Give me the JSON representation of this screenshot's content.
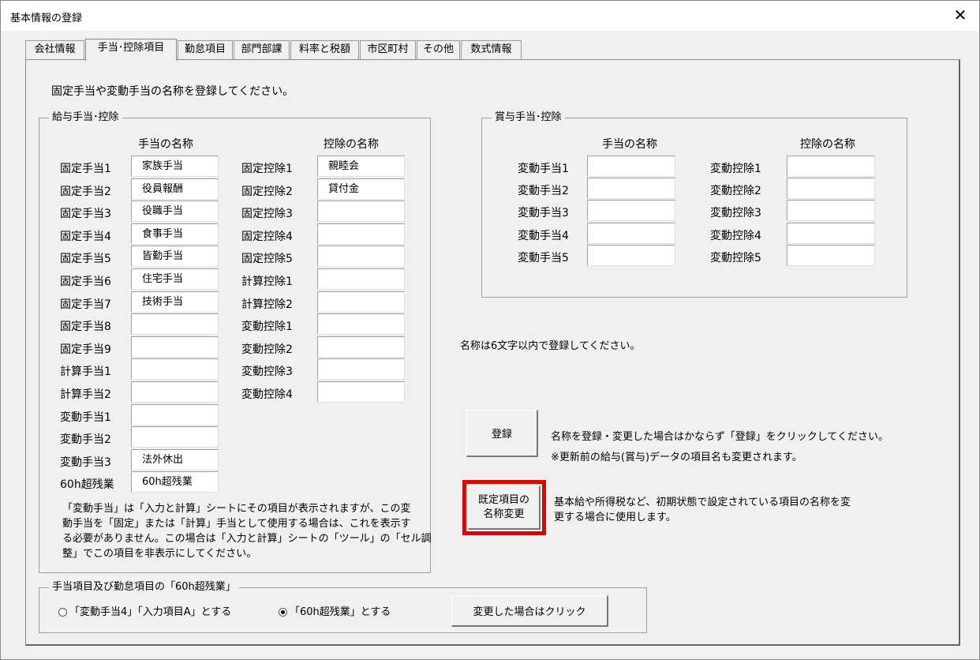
{
  "window": {
    "title": "基本情報の登録",
    "close_glyph": "✕"
  },
  "tabs": [
    "会社情報",
    "手当･控除項目",
    "勤怠項目",
    "部門部課",
    "料率と税額",
    "市区町村",
    "その他",
    "数式情報"
  ],
  "instruction": "固定手当や変動手当の名称を登録してください。",
  "salary": {
    "group_title": "給与手当･控除",
    "allow_header": "手当の名称",
    "deduct_header": "控除の名称",
    "allowances": [
      {
        "label": "固定手当1",
        "value": "家族手当"
      },
      {
        "label": "固定手当2",
        "value": "役員報酬"
      },
      {
        "label": "固定手当3",
        "value": "役職手当"
      },
      {
        "label": "固定手当4",
        "value": "食事手当"
      },
      {
        "label": "固定手当5",
        "value": "皆勤手当"
      },
      {
        "label": "固定手当6",
        "value": "住宅手当"
      },
      {
        "label": "固定手当7",
        "value": "技術手当"
      },
      {
        "label": "固定手当8",
        "value": ""
      },
      {
        "label": "固定手当9",
        "value": ""
      },
      {
        "label": "計算手当1",
        "value": ""
      },
      {
        "label": "計算手当2",
        "value": ""
      },
      {
        "label": "変動手当1",
        "value": ""
      },
      {
        "label": "変動手当2",
        "value": ""
      },
      {
        "label": "変動手当3",
        "value": "法外休出"
      },
      {
        "label": "60h超残業",
        "value": "60h超残業"
      }
    ],
    "deductions": [
      {
        "label": "固定控除1",
        "value": "親睦会"
      },
      {
        "label": "固定控除2",
        "value": "貸付金"
      },
      {
        "label": "固定控除3",
        "value": ""
      },
      {
        "label": "固定控除4",
        "value": ""
      },
      {
        "label": "固定控除5",
        "value": ""
      },
      {
        "label": "計算控除1",
        "value": ""
      },
      {
        "label": "計算控除2",
        "value": ""
      },
      {
        "label": "変動控除1",
        "value": ""
      },
      {
        "label": "変動控除2",
        "value": ""
      },
      {
        "label": "変動控除3",
        "value": ""
      },
      {
        "label": "変動控除4",
        "value": ""
      }
    ],
    "note_lines": [
      "「変動手当」は「入力と計算」シートにその項目が表示されますが、この変",
      "動手当を「固定」または「計算」手当として使用する場合は、これを表示す",
      "る必要がありません。この場合は「入力と計算」シートの「ツール」の「セル調",
      "整」でこの項目を非表示にしてください。"
    ]
  },
  "bonus": {
    "group_title": "賞与手当･控除",
    "allow_header": "手当の名称",
    "deduct_header": "控除の名称",
    "allowances": [
      {
        "label": "変動手当1",
        "value": ""
      },
      {
        "label": "変動手当2",
        "value": ""
      },
      {
        "label": "変動手当3",
        "value": ""
      },
      {
        "label": "変動手当4",
        "value": ""
      },
      {
        "label": "変動手当5",
        "value": ""
      }
    ],
    "deductions": [
      {
        "label": "変動控除1",
        "value": ""
      },
      {
        "label": "変動控除2",
        "value": ""
      },
      {
        "label": "変動控除3",
        "value": ""
      },
      {
        "label": "変動控除4",
        "value": ""
      },
      {
        "label": "変動控除5",
        "value": ""
      }
    ]
  },
  "name_limit_note": "名称は6文字以内で登録してください。",
  "register": {
    "button": "登録",
    "note1": "名称を登録・変更した場合はかならず「登録」をクリックしてください。",
    "note2": "※更新前の給与(賞与)データの項目名も変更されます。"
  },
  "rename_default": {
    "button_line1": "既定項目の",
    "button_line2": "名称変更",
    "note_line1": "基本給や所得税など、初期状態で設定されている項目の名称を変",
    "note_line2": "更する場合に使用します。",
    "highlight_color": "#e00000"
  },
  "overtime": {
    "group_title": "手当項目及び勤怠項目の「60h超残業」",
    "option1": "「変動手当4」「入力項目A」とする",
    "option2": "「60h超残業」とする",
    "selected": 2,
    "button": "変更した場合はクリック"
  }
}
